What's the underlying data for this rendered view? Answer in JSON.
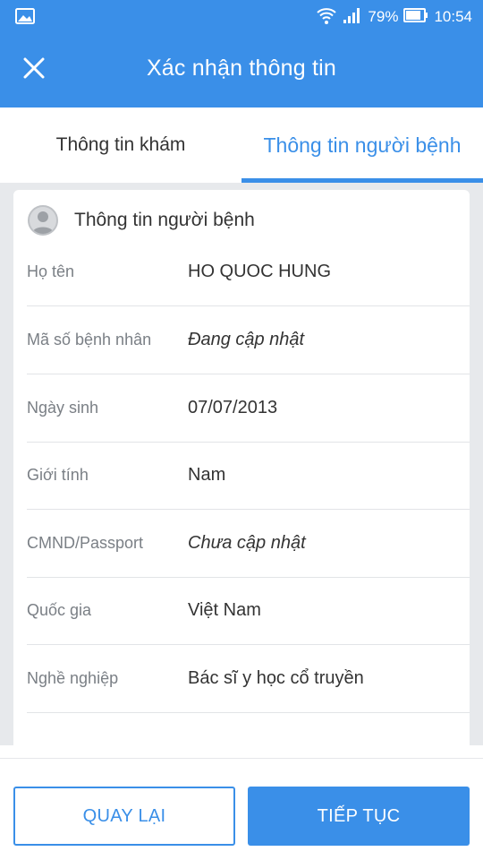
{
  "status_bar": {
    "battery_percent": "79%",
    "time": "10:54",
    "icons": [
      "gallery-icon",
      "wifi-icon",
      "signal-icon",
      "battery-icon"
    ]
  },
  "header": {
    "title": "Xác nhận thông tin",
    "close_icon": "close-icon"
  },
  "tabs": [
    {
      "label": "Thông tin khám",
      "active": false
    },
    {
      "label": "Thông tin người bệnh",
      "active": true
    }
  ],
  "card": {
    "title": "Thông tin người bệnh",
    "icon": "avatar-icon",
    "rows": [
      {
        "label": "Họ tên",
        "value": "HO QUOC HUNG",
        "italic": false
      },
      {
        "label": "Mã số bệnh nhân",
        "value": "Đang cập nhật",
        "italic": true
      },
      {
        "label": "Ngày sinh",
        "value": "07/07/2013",
        "italic": false
      },
      {
        "label": "Giới tính",
        "value": "Nam",
        "italic": false
      },
      {
        "label": "CMND/Passport",
        "value": "Chưa cập nhật",
        "italic": true
      },
      {
        "label": "Quốc gia",
        "value": "Việt Nam",
        "italic": false
      },
      {
        "label": "Nghề nghiệp",
        "value": "Bác sĩ y học cổ truyền",
        "italic": false
      }
    ]
  },
  "buttons": {
    "back_label": "QUAY LẠI",
    "next_label": "TIẾP TỤC"
  },
  "colors": {
    "primary": "#3a8fe8",
    "background": "#e7e9ec"
  }
}
